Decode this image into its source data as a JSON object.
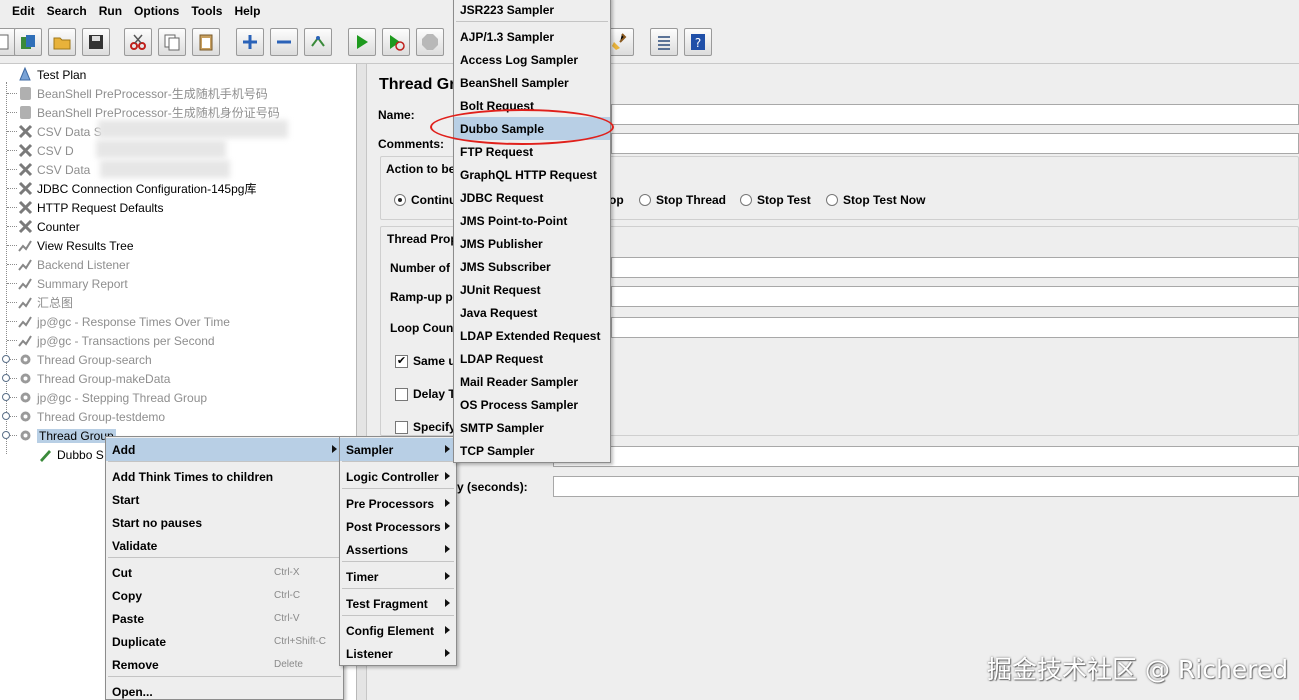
{
  "menubar": [
    "Edit",
    "Search",
    "Run",
    "Options",
    "Tools",
    "Help"
  ],
  "tree": {
    "nodes": [
      {
        "label": "Test Plan",
        "icon": "test-plan-icon",
        "disabled": false
      },
      {
        "label": "BeanShell PreProcessor-生成随机手机号码",
        "icon": "preprocessor-icon",
        "disabled": true
      },
      {
        "label": "BeanShell PreProcessor-生成随机身份证号码",
        "icon": "preprocessor-icon",
        "disabled": true
      },
      {
        "label": "CSV Data S",
        "icon": "config-element-icon",
        "disabled": true
      },
      {
        "label": "CSV D",
        "icon": "config-element-icon",
        "disabled": true
      },
      {
        "label": "CSV Data",
        "icon": "config-element-icon",
        "disabled": true
      },
      {
        "label": "JDBC Connection Configuration-145pg库",
        "icon": "config-element-icon",
        "disabled": false
      },
      {
        "label": "HTTP Request Defaults",
        "icon": "config-element-icon",
        "disabled": false
      },
      {
        "label": "Counter",
        "icon": "config-element-icon",
        "disabled": false
      },
      {
        "label": "View Results Tree",
        "icon": "listener-icon",
        "disabled": false
      },
      {
        "label": "Backend Listener",
        "icon": "listener-icon",
        "disabled": true
      },
      {
        "label": "Summary Report",
        "icon": "listener-icon",
        "disabled": true
      },
      {
        "label": "汇总图",
        "icon": "listener-icon",
        "disabled": true
      },
      {
        "label": "jp@gc - Response Times Over Time",
        "icon": "listener-icon",
        "disabled": true
      },
      {
        "label": "jp@gc - Transactions per Second",
        "icon": "listener-icon",
        "disabled": true
      },
      {
        "label": "Thread Group-search",
        "icon": "thread-group-icon",
        "disabled": true
      },
      {
        "label": "Thread Group-makeData",
        "icon": "thread-group-icon",
        "disabled": true
      },
      {
        "label": "jp@gc - Stepping Thread Group",
        "icon": "thread-group-icon",
        "disabled": true
      },
      {
        "label": "Thread Group-testdemo",
        "icon": "thread-group-icon",
        "disabled": true
      },
      {
        "label": "Thread Group",
        "icon": "thread-group-icon",
        "disabled": false,
        "selected": true
      },
      {
        "label": "Dubbo S",
        "icon": "sampler-pen-icon",
        "disabled": false
      }
    ]
  },
  "form": {
    "title": "Thread Gr",
    "name_label": "Name:",
    "comments_label": "Comments:",
    "action_label": "Action to be",
    "action_options": [
      {
        "label": "Continu",
        "selected": true
      },
      {
        "label": "op",
        "selected": false
      },
      {
        "label": "Stop Thread",
        "selected": false
      },
      {
        "label": "Stop Test",
        "selected": false
      },
      {
        "label": "Stop Test Now",
        "selected": false
      }
    ],
    "thread_props_label": "Thread Prop",
    "num_threads_label": "Number of",
    "rampup_label": "Ramp-up pe",
    "loop_label": "Loop Count",
    "same_user_label": "Same u",
    "same_user_checked": true,
    "delay_label": "Delay T",
    "delay_checked": false,
    "specify_label": "Specify",
    "specify_checked": false,
    "startup_delay_label": "y (seconds):"
  },
  "context_menu": {
    "items": [
      {
        "label": "Add",
        "submenu": true,
        "highlighted": true
      },
      {
        "label": "Add Think Times to children"
      },
      {
        "label": "Start"
      },
      {
        "label": "Start no pauses"
      },
      {
        "label": "Validate"
      },
      {
        "label": "Cut",
        "shortcut": "Ctrl-X"
      },
      {
        "label": "Copy",
        "shortcut": "Ctrl-C"
      },
      {
        "label": "Paste",
        "shortcut": "Ctrl-V"
      },
      {
        "label": "Duplicate",
        "shortcut": "Ctrl+Shift-C"
      },
      {
        "label": "Remove",
        "shortcut": "Delete"
      },
      {
        "label": "Open..."
      }
    ]
  },
  "add_submenu": {
    "items": [
      {
        "label": "Sampler",
        "highlighted": true
      },
      {
        "label": "Logic Controller"
      },
      {
        "label": "Pre Processors"
      },
      {
        "label": "Post Processors"
      },
      {
        "label": "Assertions"
      },
      {
        "label": "Timer"
      },
      {
        "label": "Test Fragment"
      },
      {
        "label": "Config Element"
      },
      {
        "label": "Listener"
      }
    ]
  },
  "sampler_submenu": {
    "items": [
      {
        "label": "JSR223 Sampler"
      },
      {
        "label": "AJP/1.3 Sampler"
      },
      {
        "label": "Access Log Sampler"
      },
      {
        "label": "BeanShell Sampler"
      },
      {
        "label": "Bolt Request"
      },
      {
        "label": "Dubbo Sample",
        "highlighted": true
      },
      {
        "label": "FTP Request"
      },
      {
        "label": "GraphQL HTTP Request"
      },
      {
        "label": "JDBC Request"
      },
      {
        "label": "JMS Point-to-Point"
      },
      {
        "label": "JMS Publisher"
      },
      {
        "label": "JMS Subscriber"
      },
      {
        "label": "JUnit Request"
      },
      {
        "label": "Java Request"
      },
      {
        "label": "LDAP Extended Request"
      },
      {
        "label": "LDAP Request"
      },
      {
        "label": "Mail Reader Sampler"
      },
      {
        "label": "OS Process Sampler"
      },
      {
        "label": "SMTP Sampler"
      },
      {
        "label": "TCP Sampler"
      }
    ]
  },
  "watermark": "掘金技术社区 @ Richered",
  "colors": {
    "highlight": "#b8cfe5",
    "annotation": "#e0201b",
    "disabled_text": "#8e8e8e"
  }
}
